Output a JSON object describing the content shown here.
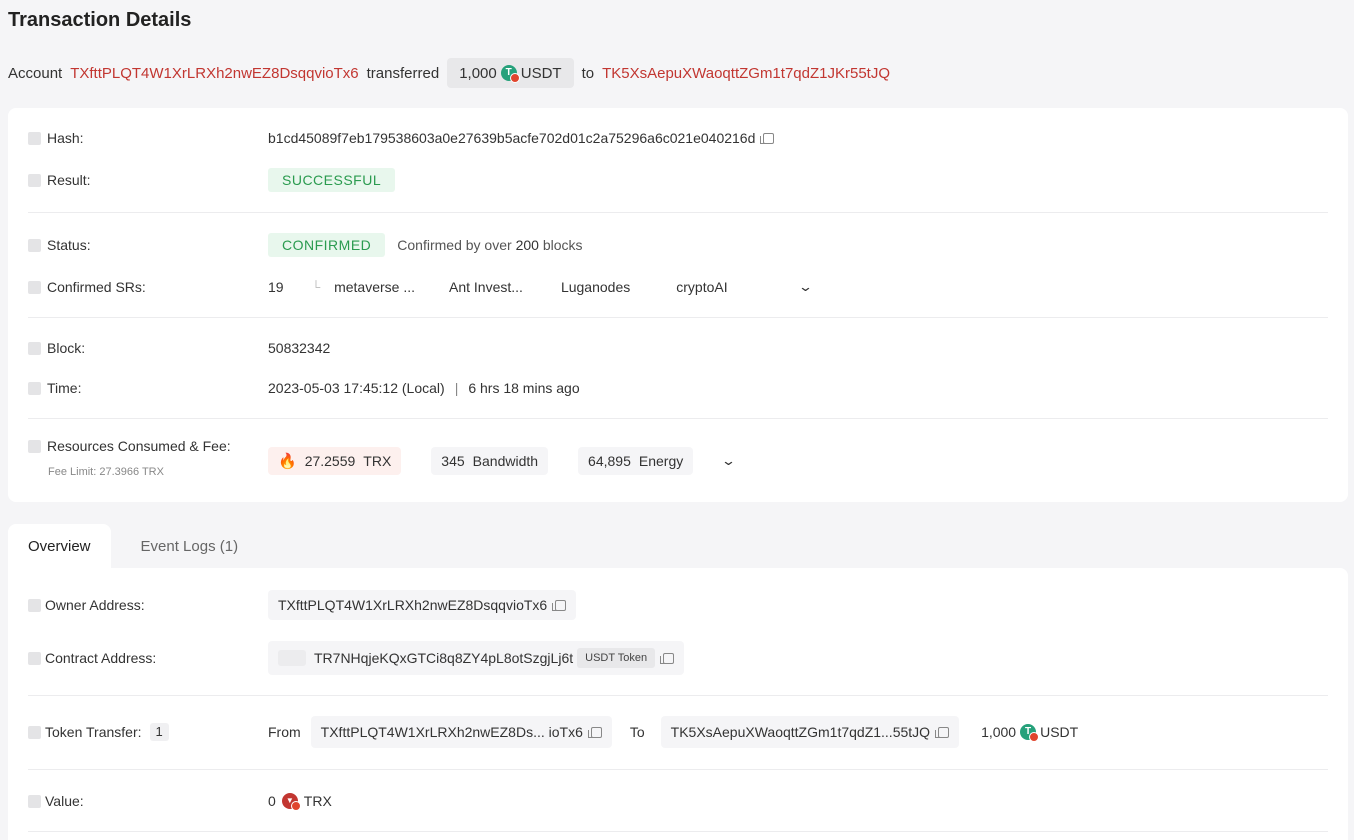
{
  "title": "Transaction Details",
  "summary": {
    "prefix": "Account",
    "from_address": "TXfttPLQT4W1XrLRXh2nwEZ8DsqqvioTx6",
    "verb": "transferred",
    "amount": "1,000",
    "token": "USDT",
    "to_word": "to",
    "to_address": "TK5XsAepuXWaoqttZGm1t7qdZ1JKr55tJQ"
  },
  "details": {
    "hash_label": "Hash:",
    "hash": "b1cd45089f7eb179538603a0e27639b5acfe702d01c2a75296a6c021e040216d",
    "result_label": "Result:",
    "result": "SUCCESSFUL",
    "status_label": "Status:",
    "status": "CONFIRMED",
    "status_sub_prefix": "Confirmed by over",
    "status_sub_count": "200",
    "status_sub_suffix": "blocks",
    "srs_label": "Confirmed SRs:",
    "srs_count": "19",
    "srs": [
      "metaverse ...",
      "Ant Invest...",
      "Luganodes",
      "cryptoAI"
    ],
    "block_label": "Block:",
    "block": "50832342",
    "time_label": "Time:",
    "time": "2023-05-03 17:45:12 (Local)",
    "time_ago": "6 hrs 18 mins ago",
    "resources_label": "Resources Consumed & Fee:",
    "fee_limit": "Fee Limit: 27.3966 TRX",
    "fee_amount": "27.2559",
    "fee_unit": "TRX",
    "bandwidth_amount": "345",
    "bandwidth_unit": "Bandwidth",
    "energy_amount": "64,895",
    "energy_unit": "Energy"
  },
  "tabs": [
    "Overview",
    "Event Logs (1)"
  ],
  "overview": {
    "owner_label": "Owner Address:",
    "owner": "TXfttPLQT4W1XrLRXh2nwEZ8DsqqvioTx6",
    "contract_label": "Contract Address:",
    "contract": "TR7NHqjeKQxGTCi8q8ZY4pL8otSzgjLj6t",
    "contract_tag": "USDT Token",
    "transfer_label": "Token Transfer:",
    "transfer_count": "1",
    "from_word": "From",
    "from": "TXfttPLQT4W1XrLRXh2nwEZ8Ds... ioTx6",
    "to_word": "To",
    "to": "TK5XsAepuXWaoqttZGm1t7qdZ1...55tJQ",
    "transfer_amount": "1,000",
    "transfer_token": "USDT",
    "value_label": "Value:",
    "value_amount": "0",
    "value_unit": "TRX"
  },
  "colors": {
    "accent_red": "#c23631",
    "success_green": "#2a9b4f"
  }
}
